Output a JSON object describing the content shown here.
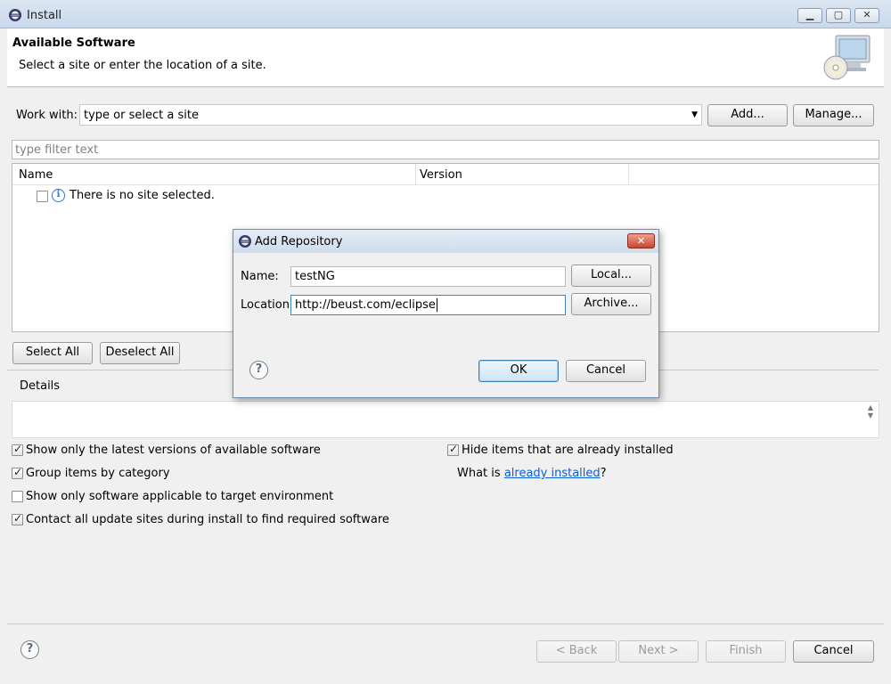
{
  "window": {
    "title": "Install",
    "controls": {
      "minimize": "▁",
      "maximize": "▢",
      "close": "✕"
    }
  },
  "header": {
    "title": "Available Software",
    "subtitle": "Select a site or enter the location of a site."
  },
  "work_with": {
    "label": "Work with:",
    "value": "type or select a site",
    "add_label": "Add...",
    "manage_label": "Manage..."
  },
  "filter": {
    "placeholder": "type filter text"
  },
  "table": {
    "columns": [
      "Name",
      "Version"
    ],
    "rows": [
      {
        "checked": false,
        "text": "There is no site selected."
      }
    ]
  },
  "selection": {
    "select_all": "Select All",
    "deselect_all": "Deselect All"
  },
  "details": {
    "label": "Details"
  },
  "options": {
    "left": [
      {
        "label": "Show only the latest versions of available software",
        "checked": true
      },
      {
        "label": "Group items by category",
        "checked": true
      },
      {
        "label": "Show only software applicable to target environment",
        "checked": false
      },
      {
        "label": "Contact all update sites during install to find required software",
        "checked": true
      }
    ],
    "hide_installed": {
      "label": "Hide items that are already installed",
      "checked": true
    },
    "what_is_prefix": "What is ",
    "what_is_link": "already installed",
    "what_is_suffix": "?"
  },
  "footer": {
    "back": "< Back",
    "next": "Next >",
    "finish": "Finish",
    "cancel": "Cancel"
  },
  "dialog": {
    "title": "Add Repository",
    "name_label": "Name:",
    "name_value": "testNG",
    "location_label": "Location:",
    "location_value": "http://beust.com/eclipse",
    "local_label": "Local...",
    "archive_label": "Archive...",
    "ok_label": "OK",
    "cancel_label": "Cancel",
    "close_glyph": "✕"
  },
  "icons": {
    "help": "?",
    "info": "i",
    "dropdown": "▼",
    "scroll_up": "▲",
    "scroll_down": "▼"
  }
}
